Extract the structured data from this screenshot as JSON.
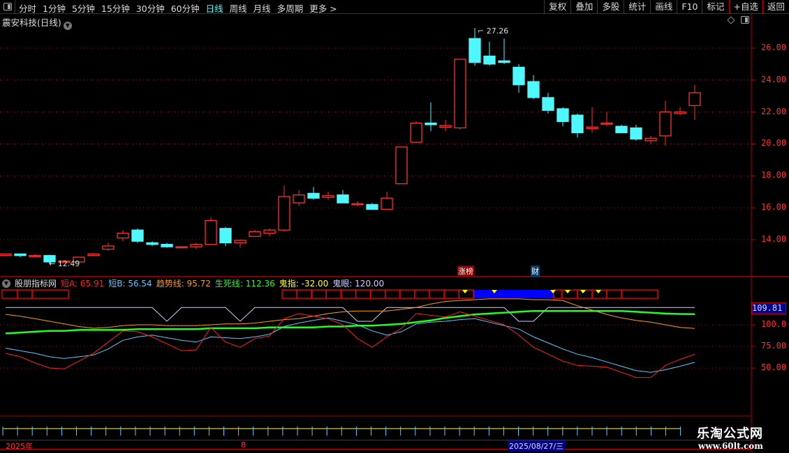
{
  "toolbar": {
    "periods": [
      "分时",
      "1分钟",
      "5分钟",
      "15分钟",
      "30分钟",
      "60分钟",
      "日线",
      "周线",
      "月线",
      "多周期",
      "更多 >"
    ],
    "active_period": "日线",
    "buttons": [
      "复权",
      "叠加",
      "多股",
      "统计",
      "画线",
      "F10",
      "标记",
      "+自选",
      "返回"
    ]
  },
  "chart_title": "震安科技(日线)",
  "price_axis": [
    "26.00",
    "24.00",
    "22.00",
    "20.00",
    "18.00",
    "16.00",
    "14.00"
  ],
  "price_labels": {
    "high": "27.26",
    "low": "12.49"
  },
  "markers": [
    {
      "text": "涨榜",
      "color": "#8b0000"
    },
    {
      "text": "财",
      "color": "#0a3a6a"
    }
  ],
  "indicator": {
    "name": "股朋指标网",
    "items": [
      {
        "label": "短A: 65.91",
        "color": "#ff2020"
      },
      {
        "label": "短B: 56.54",
        "color": "#5fc8ff"
      },
      {
        "label": "趋势线: 95.72",
        "color": "#ff9a1a"
      },
      {
        "label": "生死线: 112.36",
        "color": "#20ff20"
      },
      {
        "label": "鬼指: -32.00",
        "color": "#ffff30"
      },
      {
        "label": "鬼眼: 120.00",
        "color": "#d0d0ff"
      }
    ],
    "axis": [
      "100.0",
      "75.00",
      "50.00"
    ],
    "current_value": "109.81"
  },
  "date_bar": {
    "year": "2025年",
    "month": "8",
    "cursor_date": "2025/08/27/三"
  },
  "watermark": {
    "name": "乐淘公式网",
    "url": "www.60lt.com"
  },
  "colors": {
    "up": "#ff3030",
    "down": "#4ff8ff",
    "grid": "#b00000",
    "signal_fill": "#0000ff",
    "signal_triangle": "#ffff00"
  },
  "chart_data": {
    "type": "candlestick",
    "ylim": [
      12.2,
      27.6
    ],
    "candles": [
      [
        13.0,
        13.1,
        12.95,
        13.1
      ],
      [
        13.1,
        13.1,
        12.9,
        13.0
      ],
      [
        13.0,
        13.1,
        12.9,
        13.0
      ],
      [
        13.0,
        13.05,
        12.49,
        12.6
      ],
      [
        12.6,
        12.7,
        12.55,
        12.65
      ],
      [
        12.6,
        12.9,
        12.6,
        12.9
      ],
      [
        13.0,
        13.15,
        13.0,
        13.1
      ],
      [
        13.4,
        13.8,
        13.3,
        13.6
      ],
      [
        14.1,
        14.6,
        13.9,
        14.4
      ],
      [
        14.6,
        14.7,
        13.8,
        13.9
      ],
      [
        13.8,
        13.9,
        13.6,
        13.7
      ],
      [
        13.7,
        13.8,
        13.5,
        13.55
      ],
      [
        13.5,
        13.6,
        13.5,
        13.55
      ],
      [
        13.55,
        13.8,
        13.4,
        13.7
      ],
      [
        13.7,
        15.4,
        13.7,
        15.2
      ],
      [
        14.7,
        14.8,
        13.6,
        13.8
      ],
      [
        13.8,
        14.0,
        13.5,
        13.95
      ],
      [
        14.2,
        14.6,
        14.2,
        14.5
      ],
      [
        14.4,
        14.7,
        14.2,
        14.6
      ],
      [
        14.6,
        17.4,
        14.5,
        16.7
      ],
      [
        16.3,
        17.1,
        16.1,
        16.8
      ],
      [
        16.9,
        17.3,
        16.5,
        16.6
      ],
      [
        16.65,
        17.0,
        16.5,
        16.75
      ],
      [
        16.8,
        17.1,
        16.3,
        16.3
      ],
      [
        16.25,
        16.4,
        16.1,
        16.25
      ],
      [
        16.2,
        16.3,
        15.9,
        15.9
      ],
      [
        15.9,
        17.0,
        15.85,
        16.6
      ],
      [
        17.5,
        19.8,
        17.5,
        19.8
      ],
      [
        20.1,
        21.4,
        20.1,
        21.3
      ],
      [
        21.3,
        22.6,
        20.8,
        21.2
      ],
      [
        21.05,
        21.5,
        20.8,
        21.15
      ],
      [
        21.0,
        25.3,
        20.9,
        25.3
      ],
      [
        26.6,
        27.26,
        24.9,
        25.1
      ],
      [
        25.5,
        26.4,
        24.9,
        25.0
      ],
      [
        25.2,
        26.6,
        25.0,
        25.1
      ],
      [
        24.8,
        25.0,
        23.2,
        23.7
      ],
      [
        23.9,
        24.3,
        22.8,
        22.9
      ],
      [
        22.9,
        23.2,
        21.9,
        22.1
      ],
      [
        22.2,
        22.3,
        21.1,
        21.4
      ],
      [
        21.8,
        21.9,
        20.4,
        20.7
      ],
      [
        20.95,
        22.3,
        20.7,
        21.05
      ],
      [
        21.3,
        22.0,
        21.1,
        21.3
      ],
      [
        21.1,
        21.2,
        20.7,
        20.7
      ],
      [
        21.0,
        21.2,
        20.2,
        20.3
      ],
      [
        20.2,
        20.5,
        20.0,
        20.35
      ],
      [
        20.5,
        22.7,
        19.9,
        22.0
      ],
      [
        21.9,
        22.3,
        21.8,
        22.0
      ],
      [
        22.4,
        23.7,
        21.5,
        23.2
      ]
    ],
    "candle_fields": [
      "open",
      "high",
      "low",
      "close"
    ],
    "indicator_ylim": [
      30,
      140
    ],
    "indicator_series": [
      {
        "name": "鬼眼",
        "color": "#d0d0ff",
        "width": 1,
        "values": [
          120,
          120,
          120,
          120,
          120,
          120,
          120,
          120,
          120,
          120,
          120,
          104,
          120,
          120,
          120,
          120,
          104,
          120,
          120,
          120,
          120,
          120,
          120,
          120,
          104,
          104,
          120,
          120,
          120,
          120,
          120,
          120,
          120,
          120,
          120,
          104,
          104,
          120,
          120,
          120,
          120,
          120,
          120,
          120,
          120,
          120,
          120,
          120
        ]
      },
      {
        "name": "趋势线",
        "color": "#ff9a1a",
        "width": 1,
        "values": [
          112,
          110,
          107,
          104,
          101,
          98,
          96,
          97,
          99,
          100,
          100,
          99,
          99,
          99,
          100,
          101,
          101,
          102,
          104,
          106,
          107,
          110,
          113,
          115,
          116,
          116,
          116,
          118,
          120,
          124,
          127,
          128,
          129,
          130,
          130,
          130,
          129,
          129,
          128,
          122,
          117,
          112,
          108,
          105,
          103,
          100,
          97,
          95.72
        ]
      },
      {
        "name": "生死线",
        "color": "#20ff20",
        "width": 2.5,
        "values": [
          90,
          91,
          92,
          93,
          93,
          94,
          94,
          94,
          94,
          95,
          95,
          95,
          95,
          95,
          96,
          96,
          96,
          96,
          97,
          97,
          97,
          97,
          98,
          98,
          99,
          99,
          100,
          101,
          103,
          105,
          108,
          110,
          112,
          113,
          114,
          115,
          116,
          116,
          116,
          116,
          116,
          116,
          116,
          115,
          114,
          113,
          112.5,
          112.36
        ]
      },
      {
        "name": "短B",
        "color": "#5fc8ff",
        "width": 1,
        "values": [
          73,
          70,
          67,
          63,
          61,
          63,
          65,
          72,
          82,
          86,
          88,
          85,
          82,
          80,
          86,
          85,
          84,
          86,
          89,
          98,
          102,
          105,
          108,
          104,
          100,
          93,
          88,
          92,
          101,
          103,
          104,
          106,
          107,
          103,
          99,
          95,
          86,
          79,
          72,
          66,
          62,
          57,
          52,
          47,
          45,
          48,
          52,
          56.54
        ]
      },
      {
        "name": "短A",
        "color": "#ff2020",
        "width": 1,
        "values": [
          67,
          63,
          56,
          50,
          49,
          58,
          67,
          80,
          93,
          92,
          86,
          78,
          70,
          71,
          97,
          80,
          74,
          84,
          87,
          107,
          113,
          110,
          107,
          100,
          84,
          74,
          86,
          96,
          113,
          111,
          109,
          115,
          110,
          105,
          100,
          88,
          74,
          66,
          58,
          53,
          52,
          51,
          45,
          39,
          39,
          53,
          60,
          65.91
        ]
      }
    ],
    "signal_triangles_at_candles": [
      31,
      33,
      37,
      38,
      39,
      40
    ]
  }
}
